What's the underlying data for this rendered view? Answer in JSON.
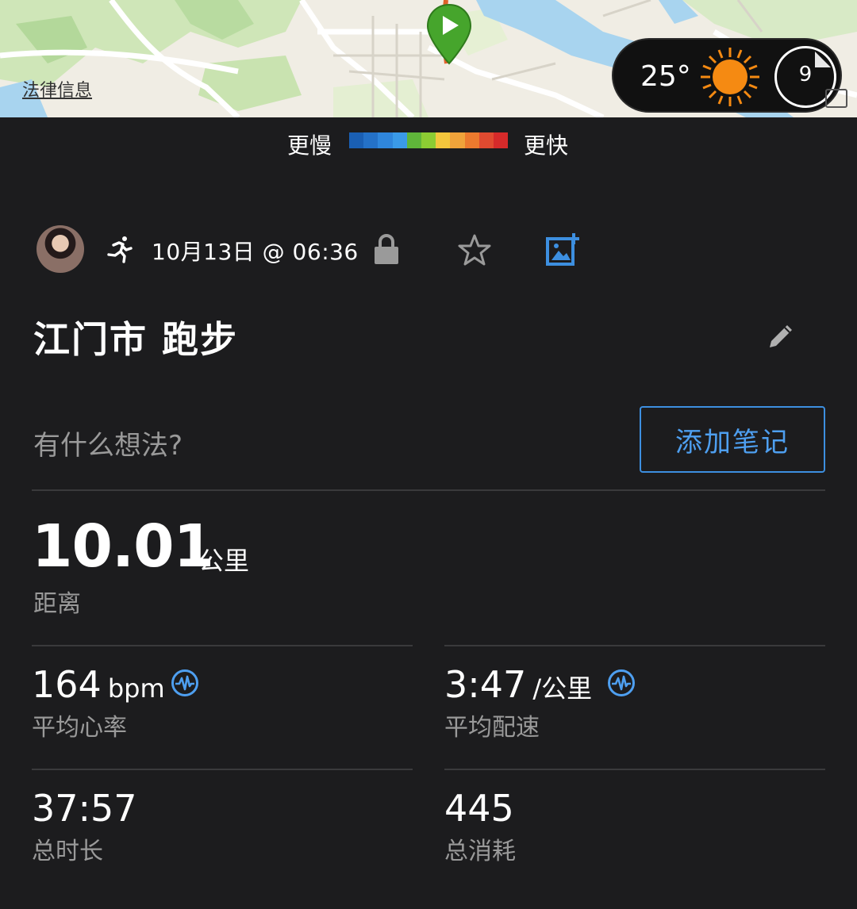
{
  "map": {
    "legal_link": "法律信息"
  },
  "weather": {
    "temperature": "25°",
    "condition_icon": "sun-icon",
    "wind_value": "9"
  },
  "pace_scale": {
    "slower_label": "更慢",
    "faster_label": "更快",
    "colors": [
      "#1a5fb4",
      "#2471c8",
      "#2f86dc",
      "#3a9ae8",
      "#5fb53a",
      "#8ccc33",
      "#f3c63c",
      "#f0a33a",
      "#ec7a2e",
      "#e04a30",
      "#d62a2a"
    ]
  },
  "activity": {
    "datetime": "10月13日 @ 06:36",
    "activity_icon": "running-icon",
    "title": "江门市 跑步",
    "thoughts_placeholder": "有什么想法?",
    "add_note_label": "添加笔记"
  },
  "stats": {
    "distance": {
      "value": "10.01",
      "unit": "公里",
      "label": "距离"
    },
    "heart_rate": {
      "value": "164",
      "unit": "bpm",
      "label": "平均心率"
    },
    "pace": {
      "value": "3:47",
      "unit": "/公里",
      "label": "平均配速"
    },
    "duration": {
      "value": "37:57",
      "label": "总时长"
    },
    "calories": {
      "value": "445",
      "label": "总消耗"
    }
  },
  "colors": {
    "background": "#1c1c1e",
    "accent": "#3d8fe0",
    "muted_text": "#9a9a9a"
  }
}
